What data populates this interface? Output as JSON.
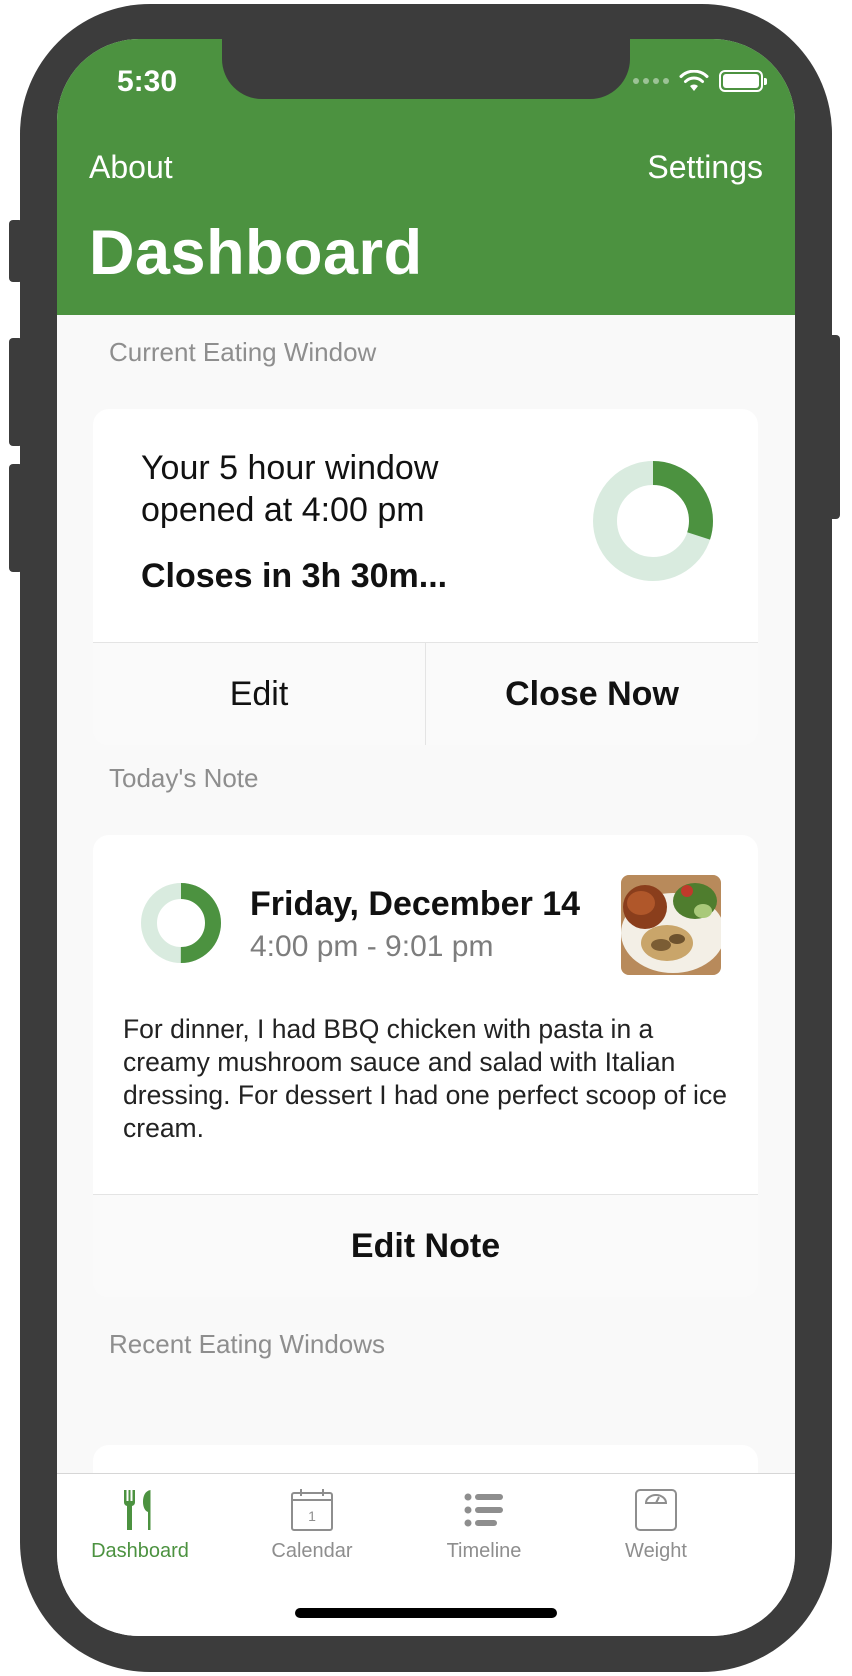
{
  "status_bar": {
    "time": "5:30"
  },
  "nav": {
    "left": "About",
    "right": "Settings",
    "title": "Dashboard"
  },
  "current_window": {
    "section_label": "Current Eating Window",
    "line1": "Your 5 hour window",
    "line2": "opened at 4:00 pm",
    "closes": "Closes in 3h 30m...",
    "progress_fraction": 0.3,
    "edit_label": "Edit",
    "close_label": "Close Now"
  },
  "today_note": {
    "section_label": "Today's Note",
    "date": "Friday, December 14",
    "time_range": "4:00 pm - 9:01 pm",
    "progress_fraction": 0.5,
    "body": "For dinner, I had BBQ chicken with pasta in a creamy mushroom sauce and salad with Italian dressing. For dessert I had one perfect scoop of ice cream.",
    "edit_label": "Edit Note"
  },
  "recent": {
    "section_label": "Recent Eating Windows"
  },
  "tabs": [
    {
      "label": "Dashboard",
      "icon": "fork-knife-icon",
      "active": true
    },
    {
      "label": "Calendar",
      "icon": "calendar-icon",
      "active": false
    },
    {
      "label": "Timeline",
      "icon": "list-icon",
      "active": false
    },
    {
      "label": "Weight",
      "icon": "scale-icon",
      "active": false
    }
  ],
  "calendar_icon_day": "1",
  "colors": {
    "brand_green": "#4c9240",
    "donut_track": "#d9ebdf",
    "secondary_text": "#8e8e8e"
  }
}
